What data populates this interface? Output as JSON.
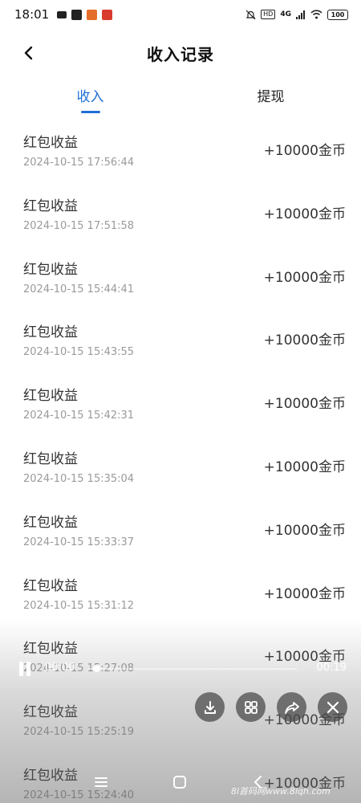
{
  "status_bar": {
    "time": "18:01",
    "hd": "HD",
    "network": "4G",
    "battery": "100"
  },
  "header": {
    "title": "收入记录",
    "back_icon": "chevron-left-icon"
  },
  "tabs": [
    {
      "label": "收入",
      "active": true
    },
    {
      "label": "提现",
      "active": false
    }
  ],
  "records": [
    {
      "title": "红包收益",
      "time": "2024-10-15 17:56:44",
      "amount": "+10000金币"
    },
    {
      "title": "红包收益",
      "time": "2024-10-15 17:51:58",
      "amount": "+10000金币"
    },
    {
      "title": "红包收益",
      "time": "2024-10-15 15:44:41",
      "amount": "+10000金币"
    },
    {
      "title": "红包收益",
      "time": "2024-10-15 15:43:55",
      "amount": "+10000金币"
    },
    {
      "title": "红包收益",
      "time": "2024-10-15 15:42:31",
      "amount": "+10000金币"
    },
    {
      "title": "红包收益",
      "time": "2024-10-15 15:35:04",
      "amount": "+10000金币"
    },
    {
      "title": "红包收益",
      "time": "2024-10-15 15:33:37",
      "amount": "+10000金币"
    },
    {
      "title": "红包收益",
      "time": "2024-10-15 15:31:12",
      "amount": "+10000金币"
    },
    {
      "title": "红包收益",
      "time": "2024-10-15 15:27:08",
      "amount": "+10000金币"
    },
    {
      "title": "红包收益",
      "time": "2024-10-15 15:25:19",
      "amount": "+10000金币"
    },
    {
      "title": "红包收益",
      "time": "2024-10-15 15:24:40",
      "amount": "+10000金币"
    }
  ],
  "player": {
    "current_time": "00:00",
    "total_time": "00:19"
  },
  "watermark": "8l首码网www.8lqh.com",
  "colors": {
    "accent": "#1f6fd6",
    "text_primary": "#333333",
    "text_secondary": "#9a9a9a"
  }
}
